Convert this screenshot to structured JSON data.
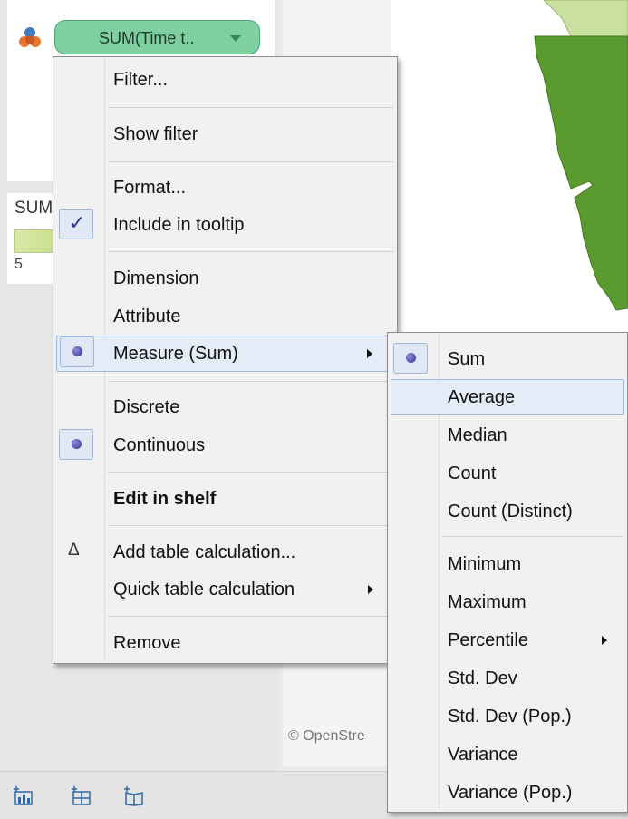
{
  "marks": {
    "pill_label": "SUM(Time t..",
    "legend_title": "SUM",
    "legend_value": "5"
  },
  "map": {
    "credit": "© OpenStre",
    "fill_color": "#5a9a2e"
  },
  "context_menu": {
    "items": [
      {
        "label": "Filter..."
      },
      {
        "label": "Show filter"
      },
      {
        "label": "Format..."
      },
      {
        "label": "Include in tooltip",
        "checked": true
      },
      {
        "label": "Dimension"
      },
      {
        "label": "Attribute"
      },
      {
        "label": "Measure (Sum)",
        "selected": true,
        "has_submenu": true
      },
      {
        "label": "Discrete"
      },
      {
        "label": "Continuous",
        "selected": true
      },
      {
        "label": "Edit in shelf",
        "bold": true
      },
      {
        "label": "Add table calculation...",
        "icon": "delta-icon"
      },
      {
        "label": "Quick table calculation",
        "has_submenu": true
      },
      {
        "label": "Remove"
      }
    ]
  },
  "submenu": {
    "items": [
      {
        "label": "Sum",
        "selected": true
      },
      {
        "label": "Average",
        "highlighted": true
      },
      {
        "label": "Median"
      },
      {
        "label": "Count"
      },
      {
        "label": "Count (Distinct)"
      },
      {
        "label": "Minimum"
      },
      {
        "label": "Maximum"
      },
      {
        "label": "Percentile",
        "has_submenu": true
      },
      {
        "label": "Std. Dev"
      },
      {
        "label": "Std. Dev (Pop.)"
      },
      {
        "label": "Variance"
      },
      {
        "label": "Variance (Pop.)"
      }
    ]
  },
  "colors": {
    "pill_fill": "#7fcfa0",
    "highlight": "#e4ecf7",
    "radio_dot": "#2f2f8f"
  }
}
